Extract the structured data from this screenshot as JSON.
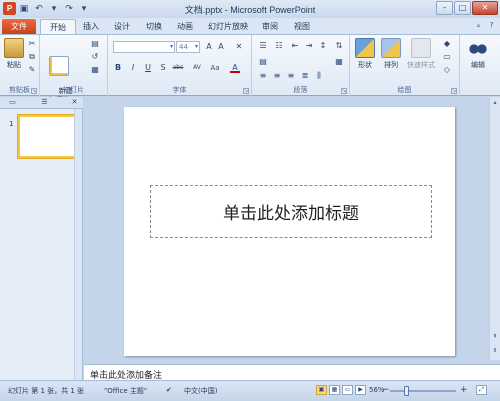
{
  "window": {
    "title": "文档.pptx - Microsoft PowerPoint",
    "app_icon_letter": "P",
    "qat_icons": [
      "save-icon",
      "undo-icon",
      "undo-dropdown-icon",
      "redo-icon",
      "customize-icon"
    ],
    "controls": {
      "minimize": "–",
      "maximize": "□",
      "close": "✕"
    }
  },
  "tabs": [
    "文件",
    "开始",
    "插入",
    "设计",
    "切换",
    "动画",
    "幻灯片放映",
    "审阅",
    "视图"
  ],
  "active_tab": "开始",
  "ribbon": {
    "clipboard": {
      "paste_label": "粘贴",
      "group": "剪贴板"
    },
    "slides": {
      "new_slide_label": "新建\n幻灯片",
      "group": "幻灯片"
    },
    "font": {
      "size_value": "44",
      "group": "字体",
      "buttons": [
        "B",
        "I",
        "U",
        "S",
        "abc",
        "AV",
        "Aa",
        "A"
      ]
    },
    "paragraph": {
      "group": "段落"
    },
    "drawing": {
      "shapes_label": "形状",
      "arrange_label": "排列",
      "quick_styles_label": "快速样式",
      "group": "绘图"
    },
    "editing": {
      "label": "编辑"
    }
  },
  "slides_panel": {
    "slide_number": "1"
  },
  "slide": {
    "title_placeholder": "单击此处添加标题"
  },
  "notes_placeholder": "单击此处添加备注",
  "status": {
    "slide_info": "幻灯片 第 1 张，共 1 张",
    "theme": "\"Office 主题\"",
    "language": "中文(中国)",
    "zoom": "56%",
    "zoom_value": 56
  },
  "colors": {
    "file_tab": "#c8431b",
    "selection_border": "#f4c842"
  }
}
